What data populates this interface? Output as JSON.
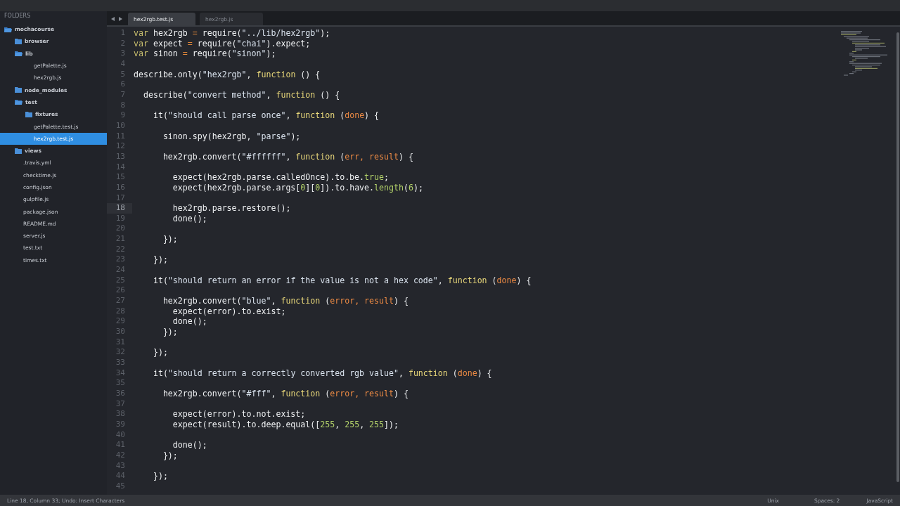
{
  "sidebar": {
    "heading": "FOLDERS",
    "tree": [
      {
        "label": "mochacourse",
        "kind": "folder",
        "expanded": true,
        "children": [
          {
            "label": "browser",
            "kind": "folder",
            "expanded": false
          },
          {
            "label": "lib",
            "kind": "folder",
            "expanded": true,
            "children": [
              {
                "label": "getPalette.js",
                "kind": "file",
                "selected": false
              },
              {
                "label": "hex2rgb.js",
                "kind": "file",
                "selected": false
              }
            ]
          },
          {
            "label": "node_modules",
            "kind": "folder",
            "expanded": false
          },
          {
            "label": "test",
            "kind": "folder",
            "expanded": true,
            "children": [
              {
                "label": "fixtures",
                "kind": "folder",
                "expanded": false
              },
              {
                "label": "getPalette.test.js",
                "kind": "file",
                "selected": false
              },
              {
                "label": "hex2rgb.test.js",
                "kind": "file",
                "selected": true
              }
            ]
          },
          {
            "label": "views",
            "kind": "folder",
            "expanded": false
          },
          {
            "label": ".travis.yml",
            "kind": "file",
            "selected": false
          },
          {
            "label": "checktime.js",
            "kind": "file",
            "selected": false
          },
          {
            "label": "config.json",
            "kind": "file",
            "selected": false
          },
          {
            "label": "gulpfile.js",
            "kind": "file",
            "selected": false
          },
          {
            "label": "package.json",
            "kind": "file",
            "selected": false
          },
          {
            "label": "README.md",
            "kind": "file",
            "selected": false
          },
          {
            "label": "server.js",
            "kind": "file",
            "selected": false
          },
          {
            "label": "test.txt",
            "kind": "file",
            "selected": false
          },
          {
            "label": "times.txt",
            "kind": "file",
            "selected": false
          }
        ]
      }
    ]
  },
  "tabs": [
    {
      "label": "hex2rgb.test.js",
      "selected": true
    },
    {
      "label": "hex2rgb.js",
      "selected": false
    }
  ],
  "editor": {
    "lines": [
      {
        "number": "1",
        "current": false,
        "tokens": [
          {
            "t": "var",
            "kind": "kw"
          },
          {
            "t": " hex2rgb ",
            "kind": "plain"
          },
          {
            "t": "=",
            "kind": "op"
          },
          {
            "t": " require(",
            "kind": "plain"
          },
          {
            "t": "\"../lib/hex2rgb\"",
            "kind": "str"
          },
          {
            "t": ");",
            "kind": "plain"
          }
        ]
      },
      {
        "number": "2",
        "current": false,
        "tokens": [
          {
            "t": "var",
            "kind": "kw"
          },
          {
            "t": " expect ",
            "kind": "plain"
          },
          {
            "t": "=",
            "kind": "op"
          },
          {
            "t": " require(",
            "kind": "plain"
          },
          {
            "t": "\"chai\"",
            "kind": "str"
          },
          {
            "t": ").expect;",
            "kind": "plain"
          }
        ]
      },
      {
        "number": "3",
        "current": false,
        "tokens": [
          {
            "t": "var",
            "kind": "kw"
          },
          {
            "t": " sinon ",
            "kind": "plain"
          },
          {
            "t": "=",
            "kind": "op"
          },
          {
            "t": " require(",
            "kind": "plain"
          },
          {
            "t": "\"sinon\"",
            "kind": "str"
          },
          {
            "t": ");",
            "kind": "plain"
          }
        ]
      },
      {
        "number": "4",
        "current": false
      },
      {
        "number": "5",
        "current": false,
        "tokens": [
          {
            "t": "describe.only(",
            "kind": "plain"
          },
          {
            "t": "\"hex2rgb\"",
            "kind": "str"
          },
          {
            "t": ", ",
            "kind": "plain"
          },
          {
            "t": "function",
            "kind": "fn"
          },
          {
            "t": " () {",
            "kind": "plain"
          }
        ]
      },
      {
        "number": "6",
        "current": false
      },
      {
        "number": "7",
        "current": false,
        "tokens": [
          {
            "t": "  describe(",
            "kind": "plain"
          },
          {
            "t": "\"convert method\"",
            "kind": "str"
          },
          {
            "t": ", ",
            "kind": "plain"
          },
          {
            "t": "function",
            "kind": "fn"
          },
          {
            "t": " () {",
            "kind": "plain"
          }
        ]
      },
      {
        "number": "8",
        "current": false
      },
      {
        "number": "9",
        "current": false,
        "tokens": [
          {
            "t": "    it(",
            "kind": "plain"
          },
          {
            "t": "\"should call parse once\"",
            "kind": "str"
          },
          {
            "t": ", ",
            "kind": "plain"
          },
          {
            "t": "function",
            "kind": "fn"
          },
          {
            "t": " (",
            "kind": "plain"
          },
          {
            "t": "done",
            "kind": "param"
          },
          {
            "t": ") {",
            "kind": "plain"
          }
        ]
      },
      {
        "number": "10",
        "current": false
      },
      {
        "number": "11",
        "current": false,
        "tokens": [
          {
            "t": "      sinon.spy(hex2rgb, ",
            "kind": "plain"
          },
          {
            "t": "\"parse\"",
            "kind": "str"
          },
          {
            "t": ");",
            "kind": "plain"
          }
        ]
      },
      {
        "number": "12",
        "current": false
      },
      {
        "number": "13",
        "current": false,
        "tokens": [
          {
            "t": "      hex2rgb.convert(",
            "kind": "plain"
          },
          {
            "t": "\"#ffffff\"",
            "kind": "str"
          },
          {
            "t": ", ",
            "kind": "plain"
          },
          {
            "t": "function",
            "kind": "fn"
          },
          {
            "t": " (",
            "kind": "plain"
          },
          {
            "t": "err, result",
            "kind": "param"
          },
          {
            "t": ") {",
            "kind": "plain"
          }
        ]
      },
      {
        "number": "14",
        "current": false
      },
      {
        "number": "15",
        "current": false,
        "tokens": [
          {
            "t": "        expect(hex2rgb.parse.calledOnce).to.be.",
            "kind": "plain"
          },
          {
            "t": "true",
            "kind": "num"
          },
          {
            "t": ";",
            "kind": "plain"
          }
        ]
      },
      {
        "number": "16",
        "current": false,
        "tokens": [
          {
            "t": "        expect(hex2rgb.parse.args[",
            "kind": "plain"
          },
          {
            "t": "0",
            "kind": "num"
          },
          {
            "t": "][",
            "kind": "plain"
          },
          {
            "t": "0",
            "kind": "num"
          },
          {
            "t": "]).to.have.",
            "kind": "plain"
          },
          {
            "t": "length",
            "kind": "num"
          },
          {
            "t": "(",
            "kind": "plain"
          },
          {
            "t": "6",
            "kind": "num"
          },
          {
            "t": ");",
            "kind": "plain"
          }
        ]
      },
      {
        "number": "17",
        "current": false
      },
      {
        "number": "18",
        "current": true,
        "tokens": [
          {
            "t": "        hex2rgb.parse.restore();",
            "kind": "plain"
          }
        ]
      },
      {
        "number": "19",
        "current": false,
        "tokens": [
          {
            "t": "        done();",
            "kind": "plain"
          }
        ]
      },
      {
        "number": "20",
        "current": false
      },
      {
        "number": "21",
        "current": false,
        "tokens": [
          {
            "t": "      });",
            "kind": "plain"
          }
        ]
      },
      {
        "number": "22",
        "current": false
      },
      {
        "number": "23",
        "current": false,
        "tokens": [
          {
            "t": "    });",
            "kind": "plain"
          }
        ]
      },
      {
        "number": "24",
        "current": false
      },
      {
        "number": "25",
        "current": false,
        "tokens": [
          {
            "t": "    it(",
            "kind": "plain"
          },
          {
            "t": "\"should return an error if the value is not a hex code\"",
            "kind": "str"
          },
          {
            "t": ", ",
            "kind": "plain"
          },
          {
            "t": "function",
            "kind": "fn"
          },
          {
            "t": " (",
            "kind": "plain"
          },
          {
            "t": "done",
            "kind": "param"
          },
          {
            "t": ") {",
            "kind": "plain"
          }
        ]
      },
      {
        "number": "26",
        "current": false
      },
      {
        "number": "27",
        "current": false,
        "tokens": [
          {
            "t": "      hex2rgb.convert(",
            "kind": "plain"
          },
          {
            "t": "\"blue\"",
            "kind": "str"
          },
          {
            "t": ", ",
            "kind": "plain"
          },
          {
            "t": "function",
            "kind": "fn"
          },
          {
            "t": " (",
            "kind": "plain"
          },
          {
            "t": "error, result",
            "kind": "param"
          },
          {
            "t": ") {",
            "kind": "plain"
          }
        ]
      },
      {
        "number": "28",
        "current": false,
        "tokens": [
          {
            "t": "        expect(error).to.exist;",
            "kind": "plain"
          }
        ]
      },
      {
        "number": "29",
        "current": false,
        "tokens": [
          {
            "t": "        done();",
            "kind": "plain"
          }
        ]
      },
      {
        "number": "30",
        "current": false,
        "tokens": [
          {
            "t": "      });",
            "kind": "plain"
          }
        ]
      },
      {
        "number": "31",
        "current": false
      },
      {
        "number": "32",
        "current": false,
        "tokens": [
          {
            "t": "    });",
            "kind": "plain"
          }
        ]
      },
      {
        "number": "33",
        "current": false
      },
      {
        "number": "34",
        "current": false,
        "tokens": [
          {
            "t": "    it(",
            "kind": "plain"
          },
          {
            "t": "\"should return a correctly converted rgb value\"",
            "kind": "str"
          },
          {
            "t": ", ",
            "kind": "plain"
          },
          {
            "t": "function",
            "kind": "fn"
          },
          {
            "t": " (",
            "kind": "plain"
          },
          {
            "t": "done",
            "kind": "param"
          },
          {
            "t": ") {",
            "kind": "plain"
          }
        ]
      },
      {
        "number": "35",
        "current": false
      },
      {
        "number": "36",
        "current": false,
        "tokens": [
          {
            "t": "      hex2rgb.convert(",
            "kind": "plain"
          },
          {
            "t": "\"#fff\"",
            "kind": "str"
          },
          {
            "t": ", ",
            "kind": "plain"
          },
          {
            "t": "function",
            "kind": "fn"
          },
          {
            "t": " (",
            "kind": "plain"
          },
          {
            "t": "error, result",
            "kind": "param"
          },
          {
            "t": ") {",
            "kind": "plain"
          }
        ]
      },
      {
        "number": "37",
        "current": false
      },
      {
        "number": "38",
        "current": false,
        "tokens": [
          {
            "t": "        expect(error).to.not.exist;",
            "kind": "plain"
          }
        ]
      },
      {
        "number": "39",
        "current": false,
        "tokens": [
          {
            "t": "        expect(result).to.deep.equal([",
            "kind": "plain"
          },
          {
            "t": "255",
            "kind": "num"
          },
          {
            "t": ", ",
            "kind": "plain"
          },
          {
            "t": "255",
            "kind": "num"
          },
          {
            "t": ", ",
            "kind": "plain"
          },
          {
            "t": "255",
            "kind": "num"
          },
          {
            "t": "]);",
            "kind": "plain"
          }
        ]
      },
      {
        "number": "40",
        "current": false
      },
      {
        "number": "41",
        "current": false,
        "tokens": [
          {
            "t": "        done();",
            "kind": "plain"
          }
        ]
      },
      {
        "number": "42",
        "current": false,
        "tokens": [
          {
            "t": "      });",
            "kind": "plain"
          }
        ]
      },
      {
        "number": "43",
        "current": false
      },
      {
        "number": "44",
        "current": false,
        "tokens": [
          {
            "t": "    });",
            "kind": "plain"
          }
        ]
      },
      {
        "number": "45",
        "current": false
      }
    ]
  },
  "status_bar": {
    "position": "Line 18, Column 33; Undo: Insert Characters",
    "line_endings": "Unix",
    "indentation": "Spaces: 2",
    "syntax": "JavaScript"
  }
}
